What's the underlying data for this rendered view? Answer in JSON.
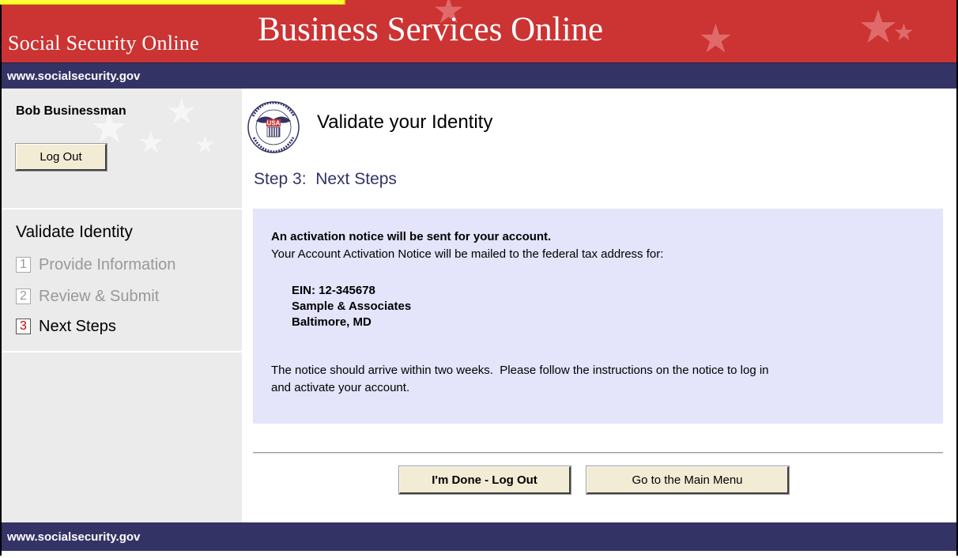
{
  "header": {
    "site_name": "Social Security Online",
    "service_name": "Business Services Online",
    "url_text": "www.socialsecurity.gov"
  },
  "sidebar": {
    "user_name": "Bob Businessman",
    "logout_label": "Log Out",
    "section_title": "Validate Identity",
    "steps": [
      {
        "number": "1",
        "label": "Provide Information",
        "state": "done"
      },
      {
        "number": "2",
        "label": "Review & Submit",
        "state": "done"
      },
      {
        "number": "3",
        "label": "Next Steps",
        "state": "active"
      }
    ]
  },
  "main": {
    "seal_alt": "Social Security Administration USA seal",
    "seal_text": "USA",
    "page_title": "Validate your Identity",
    "step_title": "Step 3:  Next Steps",
    "notice": {
      "heading": "An activation notice will be sent for your account.",
      "intro": "Your Account Activation Notice will be mailed to the federal tax address for:",
      "ein": "EIN: 12-345678",
      "company": "Sample & Associates",
      "location": "Baltimore, MD",
      "footer_line1": "The notice should arrive within two weeks.  Please follow the instructions on the notice to log in",
      "footer_line2": "and activate your account."
    },
    "buttons": {
      "done_label": "I'm Done - Log Out",
      "main_menu_label": "Go to the Main Menu"
    }
  },
  "footer": {
    "url_text": "www.socialsecurity.gov"
  },
  "colors": {
    "header_red": "#cc3333",
    "nav_blue": "#333366",
    "sidebar_gray": "#ebebeb",
    "notice_lavender": "#e4e4fa",
    "button_face": "#f2ecd5",
    "active_step_number": "#cc0000"
  }
}
